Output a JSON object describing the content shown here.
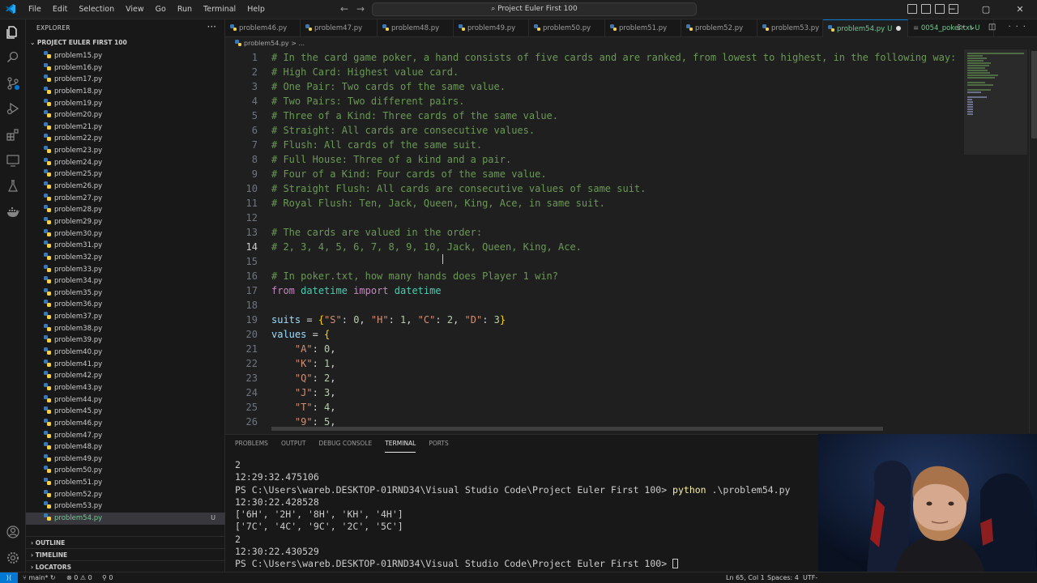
{
  "window": {
    "title": "Project Euler First 100",
    "menu": [
      "File",
      "Edit",
      "Selection",
      "View",
      "Go",
      "Run",
      "Terminal",
      "Help"
    ]
  },
  "sidebar": {
    "header": "EXPLORER",
    "project": "PROJECT EULER FIRST 100",
    "files": [
      "problem15.py",
      "problem16.py",
      "problem17.py",
      "problem18.py",
      "problem19.py",
      "problem20.py",
      "problem21.py",
      "problem22.py",
      "problem23.py",
      "problem24.py",
      "problem25.py",
      "problem26.py",
      "problem27.py",
      "problem28.py",
      "problem29.py",
      "problem30.py",
      "problem31.py",
      "problem32.py",
      "problem33.py",
      "problem34.py",
      "problem35.py",
      "problem36.py",
      "problem37.py",
      "problem38.py",
      "problem39.py",
      "problem40.py",
      "problem41.py",
      "problem42.py",
      "problem43.py",
      "problem44.py",
      "problem45.py",
      "problem46.py",
      "problem47.py",
      "problem48.py",
      "problem49.py",
      "problem50.py",
      "problem51.py",
      "problem52.py",
      "problem53.py",
      "problem54.py"
    ],
    "selected_file": "problem54.py",
    "selected_badge": "U",
    "sections": [
      "OUTLINE",
      "TIMELINE",
      "LOCATORS"
    ]
  },
  "tabs": [
    {
      "label": "problem46.py"
    },
    {
      "label": "problem47.py"
    },
    {
      "label": "problem48.py"
    },
    {
      "label": "problem49.py"
    },
    {
      "label": "problem50.py"
    },
    {
      "label": "problem51.py"
    },
    {
      "label": "problem52.py"
    },
    {
      "label": "problem53.py"
    },
    {
      "label": "problem54.py",
      "badge": "U",
      "active": true,
      "dirty": true
    },
    {
      "label": "0054_poker.txt",
      "badge": "U"
    }
  ],
  "breadcrumb": {
    "file": "problem54.py",
    "rest": "> ..."
  },
  "editor": {
    "current_line": 14,
    "lines": [
      [
        [
          "c-cm",
          "# In the card game poker, a hand consists of five cards and are ranked, from lowest to highest, in the following way:"
        ]
      ],
      [
        [
          "c-cm",
          "# High Card: Highest value card."
        ]
      ],
      [
        [
          "c-cm",
          "# One Pair: Two cards of the same value."
        ]
      ],
      [
        [
          "c-cm",
          "# Two Pairs: Two different pairs."
        ]
      ],
      [
        [
          "c-cm",
          "# Three of a Kind: Three cards of the same value."
        ]
      ],
      [
        [
          "c-cm",
          "# Straight: All cards are consecutive values."
        ]
      ],
      [
        [
          "c-cm",
          "# Flush: All cards of the same suit."
        ]
      ],
      [
        [
          "c-cm",
          "# Full House: Three of a kind and a pair."
        ]
      ],
      [
        [
          "c-cm",
          "# Four of a Kind: Four cards of the same value."
        ]
      ],
      [
        [
          "c-cm",
          "# Straight Flush: All cards are consecutive values of same suit."
        ]
      ],
      [
        [
          "c-cm",
          "# Royal Flush: Ten, Jack, Queen, King, Ace, in same suit."
        ]
      ],
      [],
      [
        [
          "c-cm",
          "# The cards are valued in the order:"
        ]
      ],
      [
        [
          "c-cm",
          "# 2, 3, 4, 5, 6, 7, 8, 9, 10, Jack, Queen, King, Ace."
        ]
      ],
      [],
      [
        [
          "c-cm",
          "# In poker.txt, how many hands does Player 1 win?"
        ]
      ],
      [
        [
          "c-kw",
          "from"
        ],
        [
          "c-pun",
          " "
        ],
        [
          "c-mod",
          "datetime"
        ],
        [
          "c-pun",
          " "
        ],
        [
          "c-kw",
          "import"
        ],
        [
          "c-pun",
          " "
        ],
        [
          "c-mod",
          "datetime"
        ]
      ],
      [],
      [
        [
          "c-var",
          "suits"
        ],
        [
          "c-pun",
          " = "
        ],
        [
          "c-br1",
          "{"
        ],
        [
          "c-str",
          "\"S\""
        ],
        [
          "c-pun",
          ": "
        ],
        [
          "c-num",
          "0"
        ],
        [
          "c-pun",
          ", "
        ],
        [
          "c-str",
          "\"H\""
        ],
        [
          "c-pun",
          ": "
        ],
        [
          "c-num",
          "1"
        ],
        [
          "c-pun",
          ", "
        ],
        [
          "c-str",
          "\"C\""
        ],
        [
          "c-pun",
          ": "
        ],
        [
          "c-num",
          "2"
        ],
        [
          "c-pun",
          ", "
        ],
        [
          "c-str",
          "\"D\""
        ],
        [
          "c-pun",
          ": "
        ],
        [
          "c-num",
          "3"
        ],
        [
          "c-br1",
          "}"
        ]
      ],
      [
        [
          "c-var",
          "values"
        ],
        [
          "c-pun",
          " = "
        ],
        [
          "c-br1",
          "{"
        ]
      ],
      [
        [
          "c-pun",
          "    "
        ],
        [
          "c-str",
          "\"A\""
        ],
        [
          "c-pun",
          ": "
        ],
        [
          "c-num",
          "0"
        ],
        [
          "c-pun",
          ","
        ]
      ],
      [
        [
          "c-pun",
          "    "
        ],
        [
          "c-str",
          "\"K\""
        ],
        [
          "c-pun",
          ": "
        ],
        [
          "c-num",
          "1"
        ],
        [
          "c-pun",
          ","
        ]
      ],
      [
        [
          "c-pun",
          "    "
        ],
        [
          "c-str",
          "\"Q\""
        ],
        [
          "c-pun",
          ": "
        ],
        [
          "c-num",
          "2"
        ],
        [
          "c-pun",
          ","
        ]
      ],
      [
        [
          "c-pun",
          "    "
        ],
        [
          "c-str",
          "\"J\""
        ],
        [
          "c-pun",
          ": "
        ],
        [
          "c-num",
          "3"
        ],
        [
          "c-pun",
          ","
        ]
      ],
      [
        [
          "c-pun",
          "    "
        ],
        [
          "c-str",
          "\"T\""
        ],
        [
          "c-pun",
          ": "
        ],
        [
          "c-num",
          "4"
        ],
        [
          "c-pun",
          ","
        ]
      ],
      [
        [
          "c-pun",
          "    "
        ],
        [
          "c-str",
          "\"9\""
        ],
        [
          "c-pun",
          ": "
        ],
        [
          "c-num",
          "5"
        ],
        [
          "c-pun",
          ","
        ]
      ]
    ]
  },
  "panel": {
    "tabs": [
      "PROBLEMS",
      "OUTPUT",
      "DEBUG CONSOLE",
      "TERMINAL",
      "PORTS"
    ],
    "active_tab": "TERMINAL",
    "terminal": [
      {
        "text": "2"
      },
      {
        "text": "12:29:32.475106"
      },
      {
        "prompt": "PS C:\\Users\\wareb.DESKTOP-01RND34\\Visual Studio Code\\Project Euler First 100> ",
        "cmd": "python",
        "args": " .\\problem54.py"
      },
      {
        "text": "12:30:22.428528"
      },
      {
        "text": "['6H', '2H', '8H', 'KH', '4H']"
      },
      {
        "text": "['7C', '4C', '9C', '2C', '5C']"
      },
      {
        "text": "2"
      },
      {
        "text": "12:30:22.430529"
      },
      {
        "prompt": "PS C:\\Users\\wareb.DESKTOP-01RND34\\Visual Studio Code\\Project Euler First 100> ",
        "cursor": true
      }
    ]
  },
  "status": {
    "branch": "main*",
    "errors": "0",
    "warnings": "0",
    "ports": "0",
    "position": "Ln 65, Col 1",
    "spaces": "Spaces: 4",
    "encoding": "UTF-"
  },
  "colors": {
    "accent": "#0078d4",
    "comment": "#6a9955",
    "keyword": "#c586c0",
    "string": "#ce9178",
    "number": "#b5cea8",
    "variable": "#9cdcfe",
    "untracked": "#73c991"
  },
  "icons": [
    "vscode-logo-icon",
    "explorer-icon",
    "search-icon",
    "source-control-icon",
    "run-debug-icon",
    "extensions-icon",
    "remote-explorer-icon",
    "testing-icon",
    "docker-icon",
    "accounts-icon",
    "settings-gear-icon"
  ]
}
